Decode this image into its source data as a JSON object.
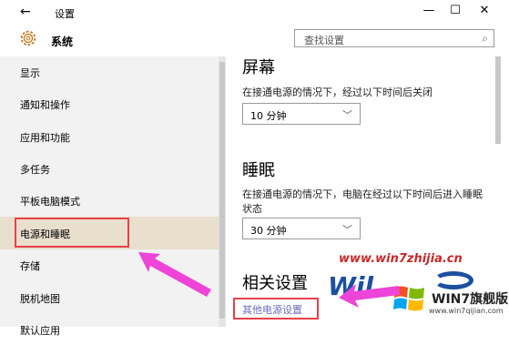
{
  "titlebar": {
    "app_title": "设置",
    "back_icon": "←",
    "minimize": "—",
    "maximize": "☐",
    "close": "✕"
  },
  "header": {
    "section_title": "系统",
    "search_placeholder": "查找设置",
    "search_icon": "⌕"
  },
  "sidebar": {
    "items": [
      {
        "label": "显示"
      },
      {
        "label": "通知和操作"
      },
      {
        "label": "应用和功能"
      },
      {
        "label": "多任务"
      },
      {
        "label": "平板电脑模式"
      },
      {
        "label": "电源和睡眠",
        "selected": true
      },
      {
        "label": "存储"
      },
      {
        "label": "脱机地图"
      },
      {
        "label": "默认应用"
      }
    ]
  },
  "main": {
    "screen": {
      "heading": "屏幕",
      "desc": "在接通电源的情况下，经过以下时间后关闭",
      "value": "10 分钟"
    },
    "sleep": {
      "heading": "睡眠",
      "desc": "在接通电源的情况下，电脑在经过以下时间后进入睡眠状态",
      "value": "30 分钟"
    },
    "related": {
      "heading": "相关设置",
      "link": "其他电源设置"
    }
  },
  "watermark": {
    "url": "www.win7zhijia.cn",
    "brand": "WIN7旗舰版",
    "site": "www.win7qijian.com",
    "big_w": "Wil"
  },
  "colors": {
    "highlight": "#e8414a",
    "arrow": "#ee44d8",
    "selected_bg": "#e9dfcd"
  }
}
